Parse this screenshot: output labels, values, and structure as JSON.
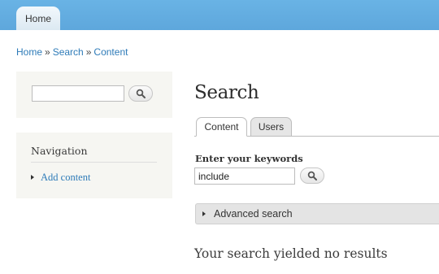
{
  "header": {
    "home_tab": "Home"
  },
  "breadcrumb": {
    "items": [
      "Home",
      "Search",
      "Content"
    ],
    "separator": "»"
  },
  "sidebar": {
    "search": {
      "value": ""
    },
    "navigation": {
      "title": "Navigation",
      "items": [
        {
          "label": "Add content"
        }
      ]
    }
  },
  "main": {
    "title": "Search",
    "tabs": [
      {
        "label": "Content",
        "active": true
      },
      {
        "label": "Users",
        "active": false
      }
    ],
    "keywords_label": "Enter your keywords",
    "keywords_value": "include",
    "advanced_label": "Advanced search",
    "no_results": "Your search yielded no results"
  },
  "icons": {
    "search_button": "magnifier-icon",
    "collapse": "triangle-right-icon"
  },
  "colors": {
    "header": "#5ea7dc",
    "link": "#2e7bb8",
    "sidebar_bg": "#f6f6f2"
  }
}
